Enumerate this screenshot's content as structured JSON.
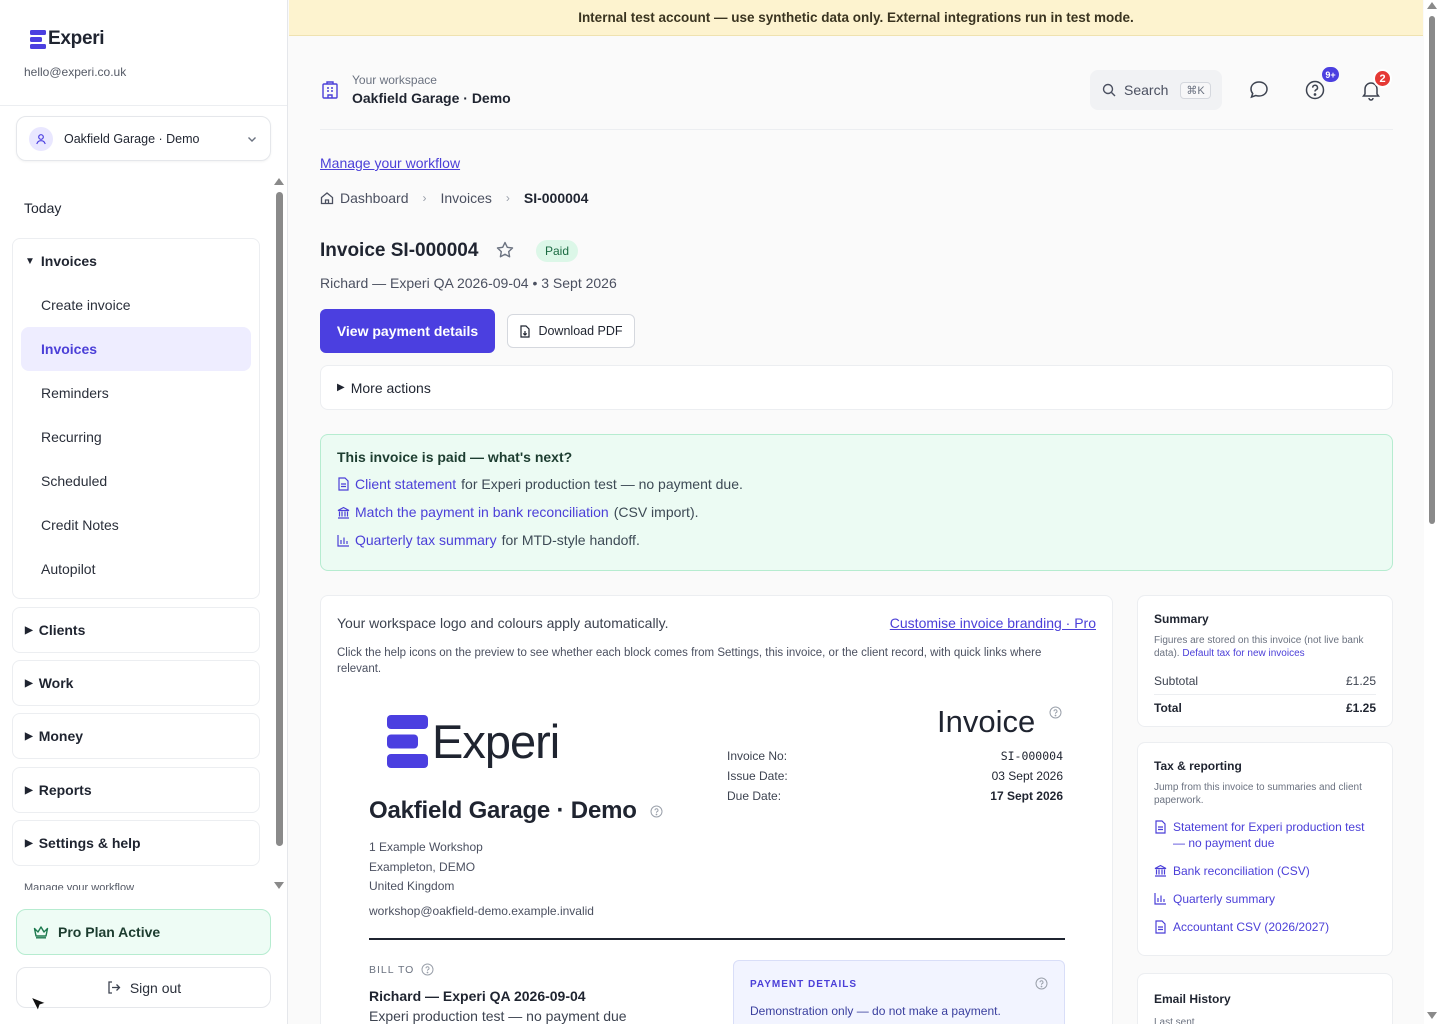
{
  "banner": "Internal test account — use synthetic data only. External integrations run in test mode.",
  "sidebar": {
    "brand": "Experi",
    "email": "hello@experi.co.uk",
    "workspace_select": "Oakfield Garage · Demo",
    "today": "Today",
    "groups": [
      {
        "label": "Invoices",
        "expanded": true,
        "items": [
          {
            "label": "Create invoice"
          },
          {
            "label": "Invoices",
            "active": true
          },
          {
            "label": "Reminders"
          },
          {
            "label": "Recurring"
          },
          {
            "label": "Scheduled"
          },
          {
            "label": "Credit Notes"
          },
          {
            "label": "Autopilot"
          }
        ]
      },
      {
        "label": "Clients"
      },
      {
        "label": "Work"
      },
      {
        "label": "Money"
      },
      {
        "label": "Reports"
      },
      {
        "label": "Settings & help"
      }
    ],
    "manage_cut": "Manage your workflow",
    "pro_plan": "Pro Plan Active",
    "sign_out": "Sign out"
  },
  "topbar": {
    "workspace_label": "Your workspace",
    "workspace_name": "Oakfield Garage · Demo",
    "search_label": "Search",
    "search_shortcut": "⌘K",
    "help_badge": "9+",
    "notif_badge": "2"
  },
  "main": {
    "manage_link": "Manage your workflow",
    "breadcrumb": [
      "Dashboard",
      "Invoices",
      "SI-000004"
    ],
    "title": "Invoice SI-000004",
    "status": "Paid",
    "meta": "Richard — Experi QA 2026-09-04 • 3 Sept 2026",
    "view_payment": "View payment details",
    "download_pdf": "Download PDF",
    "more_actions": "More actions",
    "paid_panel": {
      "title": "This invoice is paid — what's next?",
      "rows": [
        {
          "link": "Client statement",
          "rest": "for Experi production test — no payment due."
        },
        {
          "link": "Match the payment in bank reconciliation",
          "rest": "(CSV import)."
        },
        {
          "link": "Quarterly tax summary",
          "rest": "for MTD-style handoff."
        }
      ]
    }
  },
  "invoice_card": {
    "intro": "Your workspace logo and colours apply automatically.",
    "branding_link": "Customise invoice branding · Pro",
    "help": "Click the help icons on the preview to see whether each block comes from Settings, this invoice, or the client record, with quick links where relevant.",
    "doc": {
      "logo": "Experi",
      "heading": "Invoice",
      "labels": [
        "Invoice No:",
        "Issue Date:",
        "Due Date:"
      ],
      "invoice_no": "SI-000004",
      "issue_date": "03 Sept 2026",
      "due_date": "17 Sept 2026",
      "company": "Oakfield Garage · Demo",
      "address": [
        "1 Example Workshop",
        "Exampleton, DEMO",
        "United Kingdom"
      ],
      "email": "workshop@oakfield-demo.example.invalid",
      "bill_to_label": "BILL TO",
      "bill_to_name": "Richard — Experi QA 2026-09-04",
      "bill_to_sub": "Experi production test — no payment due",
      "payment_title": "PAYMENT DETAILS",
      "payment_note": "Demonstration only — do not make a payment."
    }
  },
  "summary": {
    "title": "Summary",
    "note": "Figures are stored on this invoice (not live bank data).",
    "note_link": "Default tax for new invoices",
    "subtotal_label": "Subtotal",
    "subtotal": "£1.25",
    "total_label": "Total",
    "total": "£1.25"
  },
  "tax": {
    "title": "Tax & reporting",
    "note": "Jump from this invoice to summaries and client paperwork.",
    "items": [
      {
        "label": "Statement for Experi production test — no payment due",
        "icon": "document-icon"
      },
      {
        "label": "Bank reconciliation (CSV)",
        "icon": "bank-icon"
      },
      {
        "label": "Quarterly summary",
        "icon": "bar-chart-icon"
      },
      {
        "label": "Accountant CSV (2026/2027)",
        "icon": "document-icon"
      }
    ]
  },
  "email_history": {
    "title": "Email History",
    "last_sent": "Last sent"
  },
  "colors": {
    "accent": "#4b3fe0",
    "paid_bg": "#ecfbf3",
    "banner_bg": "#fdf3cf",
    "danger": "#e53935"
  }
}
